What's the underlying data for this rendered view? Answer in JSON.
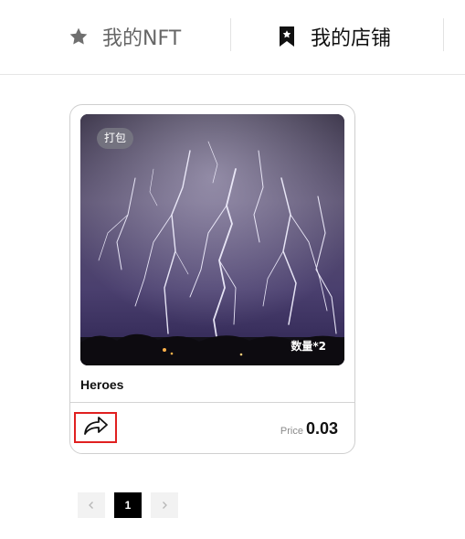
{
  "tabs": [
    {
      "label": "我的NFT",
      "icon": "star-icon",
      "active": false
    },
    {
      "label": "我的店铺",
      "icon": "bookmark-star-icon",
      "active": true
    }
  ],
  "card": {
    "badge": "打包",
    "quantity": "数量*2",
    "title": "Heroes",
    "price_label": "Price",
    "price_value": "0.03",
    "share_icon": "share-arrow-icon"
  },
  "pagination": {
    "prev_icon": "chevron-left-icon",
    "current_page": "1",
    "next_icon": "chevron-right-icon"
  },
  "colors": {
    "highlight_border": "#e02020",
    "active_page_bg": "#000000"
  }
}
